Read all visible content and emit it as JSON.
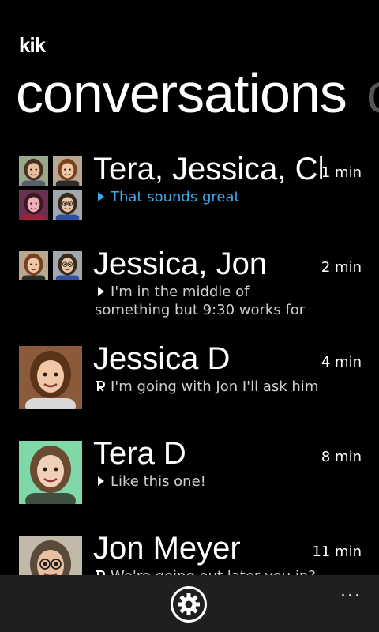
{
  "app": {
    "logo": "kik",
    "title": "conversations",
    "next_pivot_peek": "c"
  },
  "conversations": [
    {
      "name": "Tera, Jessica, Ch",
      "time": "1 min",
      "preview": "That sounds great",
      "status": "unread",
      "avatars": [
        "girl-brown-hair",
        "girl-auburn-hair",
        "girl-red-lips",
        "boy-glasses"
      ]
    },
    {
      "name": "Jessica, Jon",
      "time": "2 min",
      "preview": "I'm in the middle of something but 9:30 works for",
      "status": "delivered",
      "avatars": [
        "girl-auburn-hair",
        "boy-glasses"
      ]
    },
    {
      "name": "Jessica D",
      "time": "4 min",
      "preview": "I'm going with Jon I'll ask him",
      "status": "read",
      "avatars": [
        "girl-smiling"
      ]
    },
    {
      "name": "Tera D",
      "time": "8 min",
      "preview": "Like this one!",
      "status": "delivered",
      "avatars": [
        "girl-green-background"
      ]
    },
    {
      "name": "Jon Meyer",
      "time": "11 min",
      "preview": "We're going out later you in?",
      "status": "read",
      "avatars": [
        "boy-glasses-smiling"
      ]
    }
  ],
  "app_bar": {
    "settings_icon": "gear-icon",
    "more_icon": "ellipsis-icon",
    "more_label": "..."
  },
  "colors": {
    "background": "#000000",
    "accent": "#3fa9e9",
    "app_bar": "#1f1f1f"
  }
}
